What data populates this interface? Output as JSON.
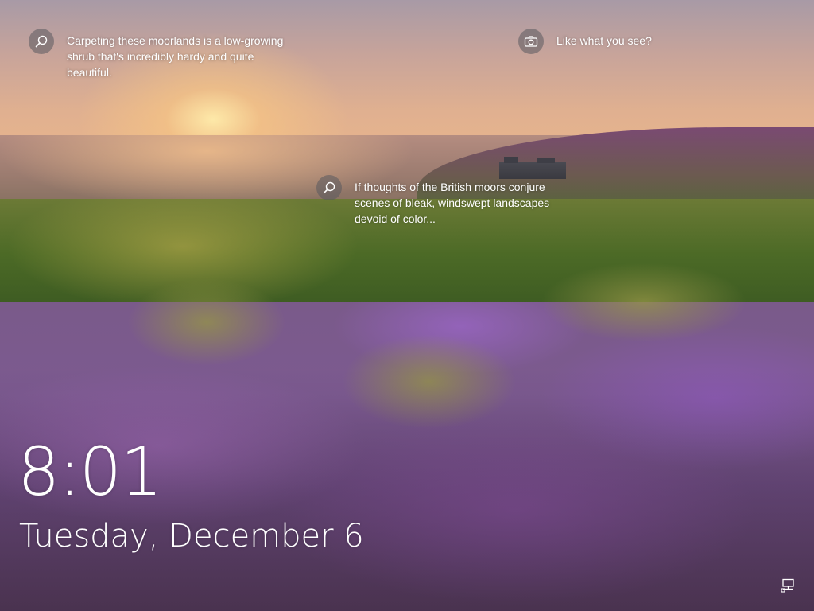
{
  "lockscreen": {
    "hotspots": [
      {
        "icon": "search-icon",
        "text": "Carpeting these moorlands is a low-growing shrub that's incredibly hardy and quite beautiful."
      },
      {
        "icon": "camera-icon",
        "text": "Like what you see?"
      },
      {
        "icon": "search-icon",
        "text": "If thoughts of the British moors conjure scenes of bleak, windswept landscapes devoid of color..."
      }
    ],
    "time": "8:01",
    "date": "Tuesday, December 6",
    "status_icons": [
      "network-icon"
    ]
  }
}
